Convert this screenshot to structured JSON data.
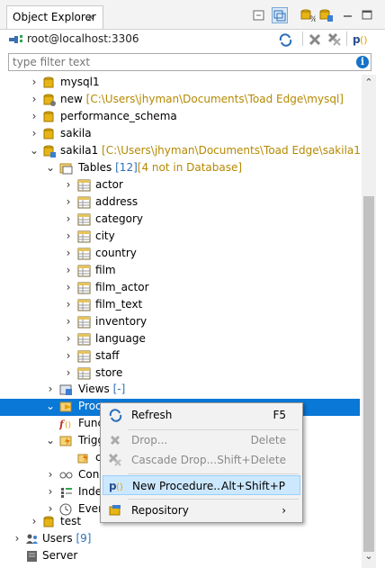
{
  "panel": {
    "tab_title": "Object Explorer",
    "close_glyph": "×",
    "connection": "root@localhost:3306",
    "filter_placeholder": "type filter text",
    "info_glyph": "i"
  },
  "tree": {
    "mysql1": "mysql1",
    "new": "new",
    "new_path": "[C:\\Users\\jhyman\\Documents\\Toad Edge\\mysql]",
    "performance_schema": "performance_schema",
    "sakila": "sakila",
    "sakila1": "sakila1",
    "sakila1_path": "[C:\\Users\\jhyman\\Documents\\Toad Edge\\sakila1]",
    "tables": "Tables",
    "tables_count": "[12]",
    "tables_note": "[4 not in Database]",
    "table_items": [
      "actor",
      "address",
      "category",
      "city",
      "country",
      "film",
      "film_actor",
      "film_text",
      "inventory",
      "language",
      "staff",
      "store"
    ],
    "views": "Views",
    "views_count": "[-]",
    "procedures": "Proce",
    "functions": "Func",
    "triggers": "Trigg",
    "trigger_child": "c",
    "constraints": "Cons",
    "indexes": "Inde",
    "events": "Even",
    "test": "test",
    "users": "Users",
    "users_count": "[9]",
    "server": "Server"
  },
  "menu": {
    "items": [
      {
        "label": "Refresh",
        "shortcut": "F5"
      },
      {
        "label": "Drop...",
        "shortcut": "Delete"
      },
      {
        "label": "Cascade Drop...",
        "shortcut": "Shift+Delete"
      },
      {
        "label": "New Procedure...",
        "shortcut": "Alt+Shift+P"
      },
      {
        "label": "Repository",
        "shortcut": "›"
      }
    ]
  },
  "colors": {
    "selection": "#0a78d7",
    "path_text": "#b58900",
    "count_text": "#2a6fb8",
    "menu_hover": "#cce8ff"
  }
}
